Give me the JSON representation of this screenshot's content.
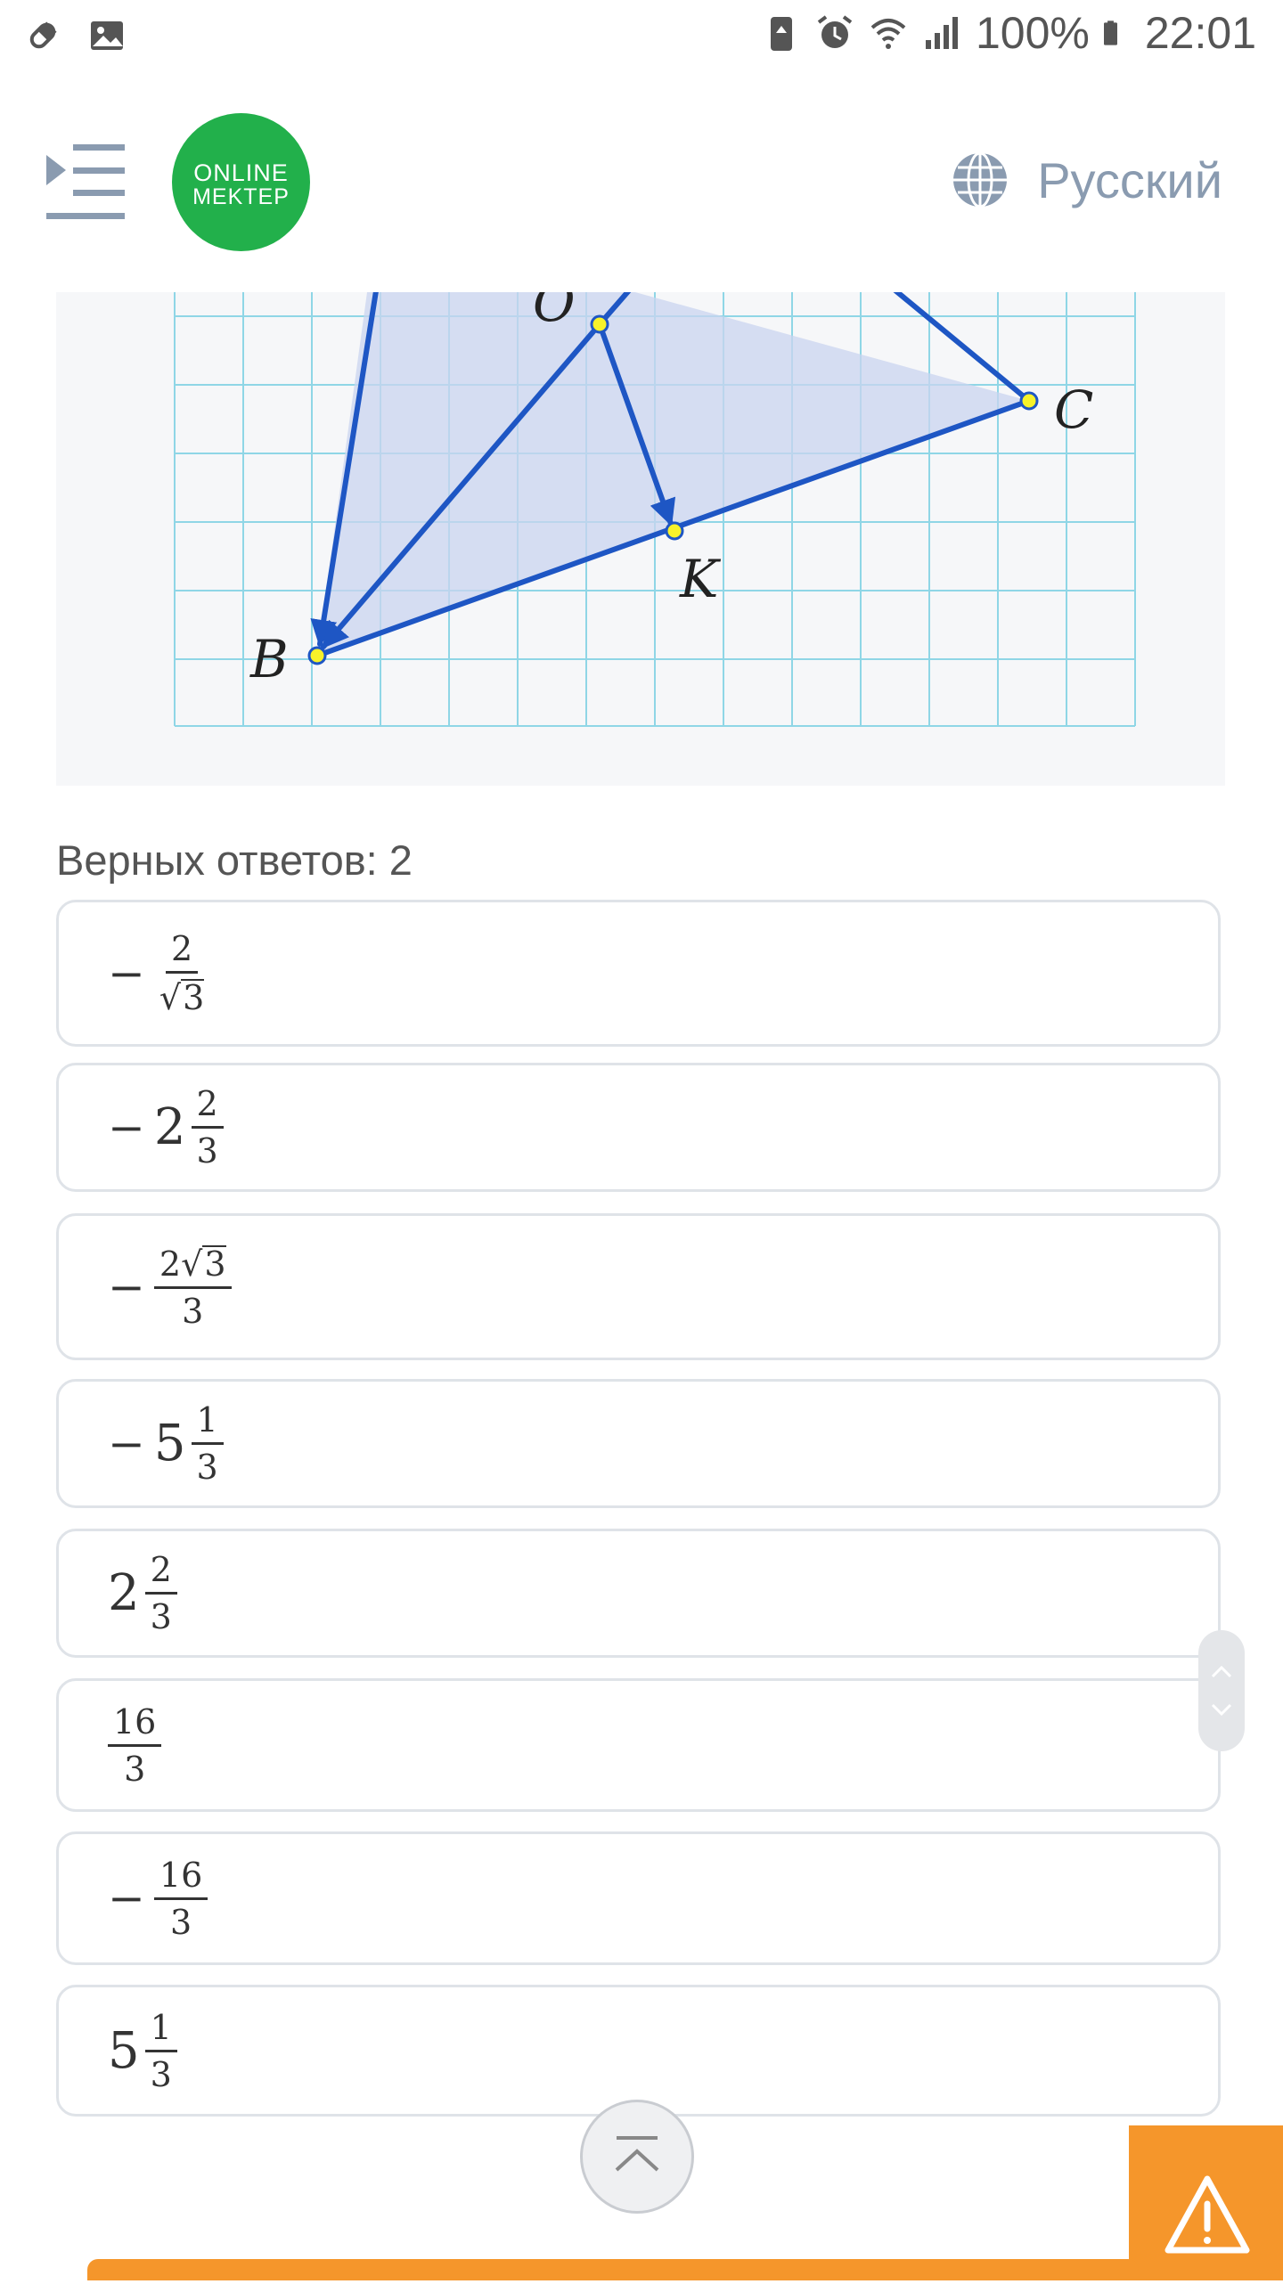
{
  "status_bar": {
    "battery_percent": "100%",
    "time": "22:01",
    "left_icons": [
      "pill-icon",
      "image-icon"
    ],
    "right_icons": [
      "battery-saver-icon",
      "alarm-icon",
      "wifi-icon",
      "signal-icon",
      "battery-icon"
    ]
  },
  "header": {
    "logo_line1": "ONLINE",
    "logo_line2": "MEKTEP",
    "language": "Русский"
  },
  "figure": {
    "points": [
      "O",
      "C",
      "K",
      "B"
    ]
  },
  "question": {
    "answers_label": "Верных ответов: 2"
  },
  "options": [
    {
      "minus": "−",
      "num": "2",
      "den": "3",
      "den_sqrt": true
    },
    {
      "minus": "−",
      "whole": "2",
      "num": "2",
      "den": "3"
    },
    {
      "minus": "−",
      "num_coef": "2",
      "num_sqrt": "3",
      "den": "3"
    },
    {
      "minus": "−",
      "whole": "5",
      "num": "1",
      "den": "3"
    },
    {
      "whole": "2",
      "num": "2",
      "den": "3"
    },
    {
      "num": "16",
      "den": "3"
    },
    {
      "minus": "−",
      "num": "16",
      "den": "3"
    },
    {
      "whole": "5",
      "num": "1",
      "den": "3"
    }
  ],
  "colors": {
    "brand_green": "#22b04b",
    "accent_orange": "#f5962b",
    "figure_line": "#1e56c4",
    "grid_line": "#7fd0e0"
  }
}
